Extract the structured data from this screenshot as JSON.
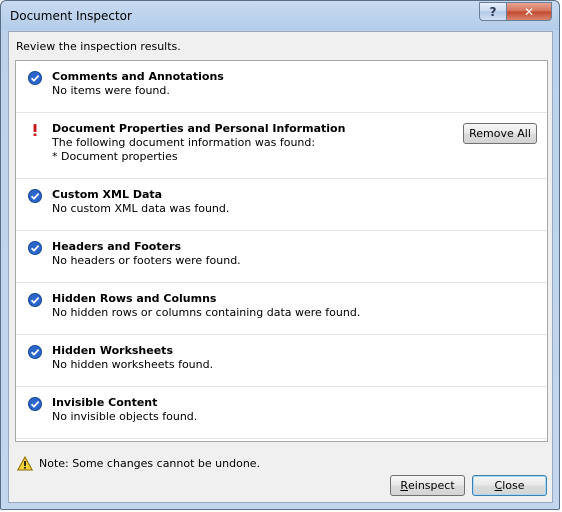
{
  "window": {
    "title": "Document Inspector",
    "help_glyph": "?",
    "close_glyph": "✕"
  },
  "prompt": "Review the inspection results.",
  "items": [
    {
      "status": "ok",
      "title": "Comments and Annotations",
      "desc": "No items were found."
    },
    {
      "status": "warning",
      "title": "Document Properties and Personal Information",
      "desc": "The following document information was found:",
      "sub": "* Document properties",
      "action_label": "Remove All"
    },
    {
      "status": "ok",
      "title": "Custom XML Data",
      "desc": "No custom XML data was found."
    },
    {
      "status": "ok",
      "title": "Headers and Footers",
      "desc": "No headers or footers were found."
    },
    {
      "status": "ok",
      "title": "Hidden Rows and Columns",
      "desc": "No hidden rows or columns containing data were found."
    },
    {
      "status": "ok",
      "title": "Hidden Worksheets",
      "desc": "No hidden worksheets found."
    },
    {
      "status": "ok",
      "title": "Invisible Content",
      "desc": "No invisible objects found."
    }
  ],
  "note": "Note: Some changes cannot be undone.",
  "buttons": {
    "reinspect": {
      "mnemonic": "R",
      "rest": "einspect"
    },
    "close": {
      "mnemonic": "C",
      "rest": "lose"
    }
  },
  "colors": {
    "ok": "#2a66c9",
    "warning": "#c81a1a"
  }
}
